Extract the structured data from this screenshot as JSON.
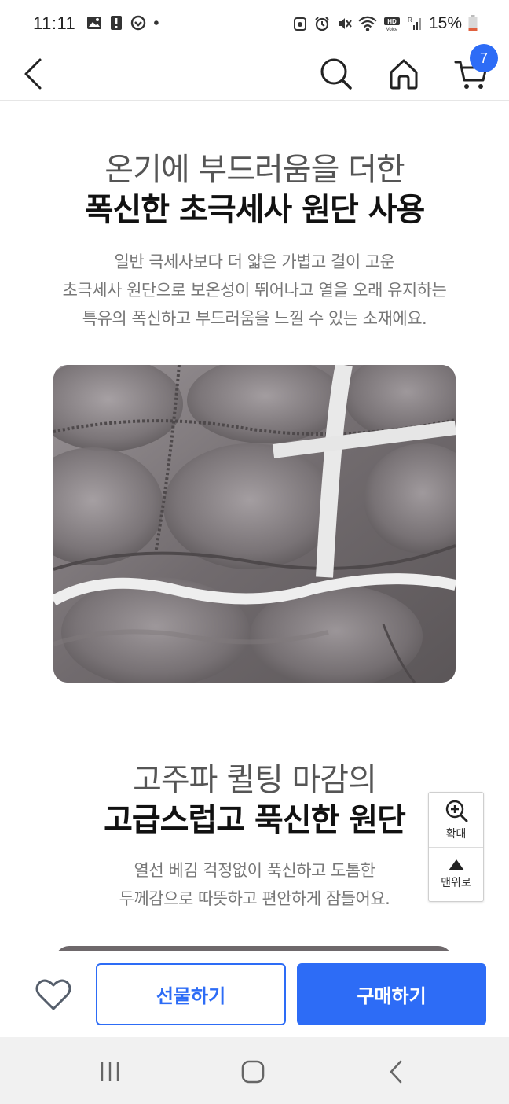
{
  "status_bar": {
    "time": "11:11",
    "battery": "15%",
    "icons": [
      "image-icon",
      "alert-icon",
      "pay-icon",
      "dot-icon",
      "recycle-icon",
      "alarm-icon",
      "mute-icon",
      "wifi-icon",
      "hd-voice-icon",
      "signal-icon",
      "battery-icon"
    ]
  },
  "top_nav": {
    "cart_count": "7",
    "icons": [
      "back-arrow-icon",
      "search-icon",
      "home-icon",
      "cart-icon"
    ]
  },
  "section1": {
    "heading_light": "온기에 부드러움을 더한",
    "heading_bold": "폭신한 초극세사 원단 사용",
    "desc_lines": [
      "일반 극세사보다 더 얇은 가볍고 결이 고운",
      "초극세사 원단으로 보온성이 뛰어나고 열을 오래 유지하는",
      "특유의 폭신하고 부드러움을 느낄 수 있는 소재에요."
    ]
  },
  "section2": {
    "heading_light": "고주파 퀼팅 마감의",
    "heading_bold": "고급스럽고 푹신한 원단",
    "desc_lines": [
      "열선 베김 걱정없이 푹신하고 도톰한",
      "두께감으로 따뜻하고 편안하게 잠들어요."
    ]
  },
  "float": {
    "zoom_label": "확대",
    "top_label": "맨위로"
  },
  "action_bar": {
    "gift_label": "선물하기",
    "buy_label": "구매하기"
  },
  "colors": {
    "accent": "#2d6cf6",
    "fabric_gray": "#7d777a"
  }
}
